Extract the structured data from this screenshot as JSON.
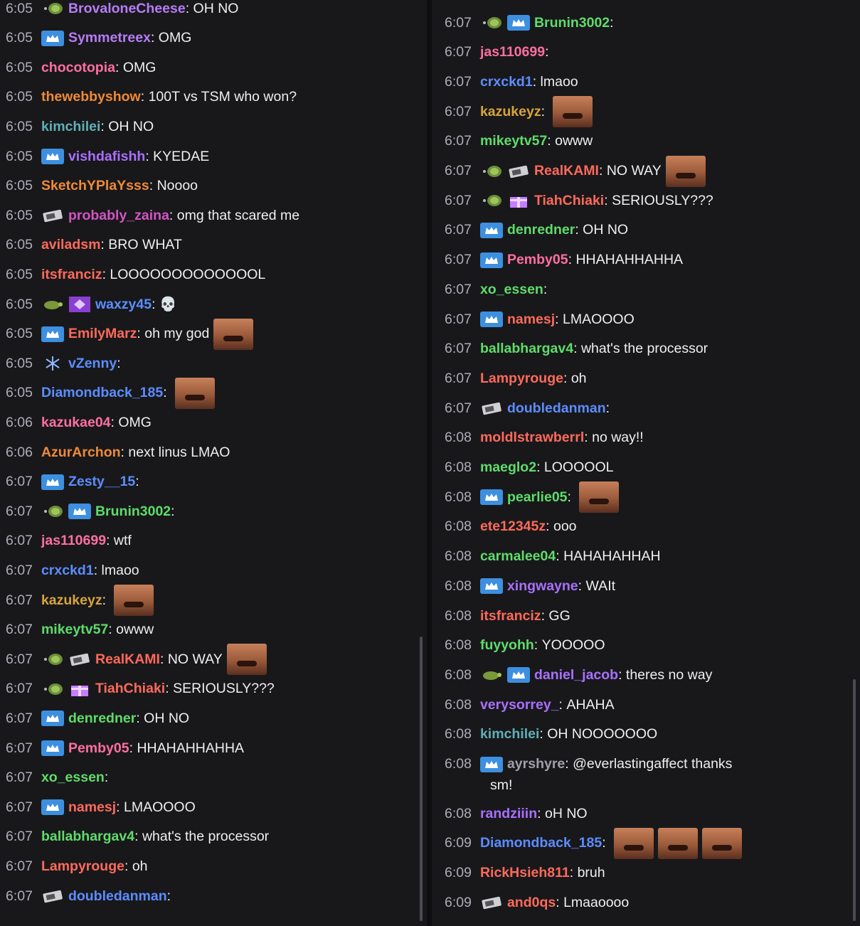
{
  "left": [
    {
      "time": "6:05",
      "badges": [
        "dot-icon"
      ],
      "user": "BrovaloneCheese",
      "color": "#b77cf5",
      "text": "OH NO",
      "emotes": 0
    },
    {
      "time": "6:05",
      "badges": [
        "crown-icon"
      ],
      "user": "Symmetreex",
      "color": "#b77cf5",
      "text": "OMG",
      "emotes": 0
    },
    {
      "time": "6:05",
      "badges": [],
      "user": "chocotopia",
      "color": "#ff6f9f",
      "text": "OMG",
      "emotes": 0
    },
    {
      "time": "6:05",
      "badges": [],
      "user": "thewebbyshow",
      "color": "#f08a38",
      "text": "100T vs TSM who won?",
      "emotes": 0
    },
    {
      "time": "6:05",
      "badges": [],
      "user": "kimchilei",
      "color": "#5fb0b6",
      "text": "OH NO",
      "emotes": 0
    },
    {
      "time": "6:05",
      "badges": [
        "crown-icon"
      ],
      "user": "vishdafishh",
      "color": "#a970ff",
      "text": "KYEDAE",
      "emotes": 0
    },
    {
      "time": "6:05",
      "badges": [],
      "user": "SketchYPlaYsss",
      "color": "#f08a38",
      "text": "Noooo",
      "emotes": 0
    },
    {
      "time": "6:05",
      "badges": [
        "gpu-icon"
      ],
      "user": "probably_zaina",
      "color": "#d254c4",
      "text": "omg that scared me",
      "emotes": 0
    },
    {
      "time": "6:05",
      "badges": [],
      "user": "aviladsm",
      "color": "#ff6a5a",
      "text": "BRO WHAT",
      "emotes": 0
    },
    {
      "time": "6:05",
      "badges": [],
      "user": "itsfranciz",
      "color": "#ff6a5a",
      "text": "LOOOOOOOOOOOOOL",
      "emotes": 0
    },
    {
      "time": "6:05",
      "badges": [
        "turtle-icon",
        "diamond-icon"
      ],
      "user": "waxzy45",
      "color": "#5c8dff",
      "text": "💀",
      "emotes": 0
    },
    {
      "time": "6:05",
      "badges": [
        "crown-icon"
      ],
      "user": "EmilyMarz",
      "color": "#ff6a5a",
      "text": "oh my god",
      "emotes": 1
    },
    {
      "time": "6:05",
      "badges": [
        "snowflake-icon"
      ],
      "user": "vZenny",
      "color": "#5c8dff",
      "text": "",
      "emotes": 0
    },
    {
      "time": "6:05",
      "badges": [],
      "user": "Diamondback_185",
      "color": "#5c8dff",
      "text": "",
      "emotes": 1
    },
    {
      "time": "6:06",
      "badges": [],
      "user": "kazukae04",
      "color": "#ff6f9f",
      "text": "OMG",
      "emotes": 0
    },
    {
      "time": "6:06",
      "badges": [],
      "user": "AzurArchon",
      "color": "#f08a38",
      "text": "next linus LMAO",
      "emotes": 0
    },
    {
      "time": "6:07",
      "badges": [
        "crown-icon"
      ],
      "user": "Zesty__15",
      "color": "#5c8dff",
      "text": "",
      "emotes": 0
    },
    {
      "time": "6:07",
      "badges": [
        "dot-icon",
        "crown-icon"
      ],
      "user": "Brunin3002",
      "color": "#5fdc6a",
      "text": "",
      "emotes": 0
    },
    {
      "time": "6:07",
      "badges": [],
      "user": "jas110699",
      "color": "#ff6f9f",
      "text": "wtf",
      "emotes": 0
    },
    {
      "time": "6:07",
      "badges": [],
      "user": "crxckd1",
      "color": "#5c8dff",
      "text": "lmaoo",
      "emotes": 0
    },
    {
      "time": "6:07",
      "badges": [],
      "user": "kazukeyz",
      "color": "#d8a43a",
      "text": "",
      "emotes": 1
    },
    {
      "time": "6:07",
      "badges": [],
      "user": "mikeytv57",
      "color": "#5fdc6a",
      "text": "owww",
      "emotes": 0
    },
    {
      "time": "6:07",
      "badges": [
        "dot-icon",
        "gpu-icon"
      ],
      "user": "RealKAMI",
      "color": "#ff6a5a",
      "text": "NO WAY",
      "emotes": 1
    },
    {
      "time": "6:07",
      "badges": [
        "dot-icon",
        "gift-icon"
      ],
      "user": "TiahChiaki",
      "color": "#ff6a5a",
      "text": "SERIOUSLY???",
      "emotes": 0
    },
    {
      "time": "6:07",
      "badges": [
        "crown-icon"
      ],
      "user": "denredner",
      "color": "#5fdc6a",
      "text": "OH NO",
      "emotes": 0
    },
    {
      "time": "6:07",
      "badges": [
        "crown-icon"
      ],
      "user": "Pemby05",
      "color": "#ff6f9f",
      "text": "HHAHAHHAHHA",
      "emotes": 0
    },
    {
      "time": "6:07",
      "badges": [],
      "user": "xo_essen",
      "color": "#5fdc6a",
      "text": "",
      "emotes": 0
    },
    {
      "time": "6:07",
      "badges": [
        "crown-icon"
      ],
      "user": "namesj",
      "color": "#ff6a5a",
      "text": "LMAOOOO",
      "emotes": 0
    },
    {
      "time": "6:07",
      "badges": [],
      "user": "ballabhargav4",
      "color": "#5fdc6a",
      "text": "what's the processor",
      "emotes": 0
    },
    {
      "time": "6:07",
      "badges": [],
      "user": "Lampyrouge",
      "color": "#ff6a5a",
      "text": "oh",
      "emotes": 0
    },
    {
      "time": "6:07",
      "badges": [
        "gpu-icon"
      ],
      "user": "doubledanman",
      "color": "#5c8dff",
      "text": "",
      "emotes": 0
    }
  ],
  "right": [
    {
      "time": "6:07",
      "badges": [
        "dot-icon",
        "crown-icon"
      ],
      "user": "Brunin3002",
      "color": "#5fdc6a",
      "text": "",
      "emotes": 0
    },
    {
      "time": "6:07",
      "badges": [],
      "user": "jas110699",
      "color": "#ff6f9f",
      "text": "",
      "emotes": 0
    },
    {
      "time": "6:07",
      "badges": [],
      "user": "crxckd1",
      "color": "#5c8dff",
      "text": "lmaoo",
      "emotes": 0
    },
    {
      "time": "6:07",
      "badges": [],
      "user": "kazukeyz",
      "color": "#d8a43a",
      "text": "",
      "emotes": 1
    },
    {
      "time": "6:07",
      "badges": [],
      "user": "mikeytv57",
      "color": "#5fdc6a",
      "text": "owww",
      "emotes": 0
    },
    {
      "time": "6:07",
      "badges": [
        "dot-icon",
        "gpu-icon"
      ],
      "user": "RealKAMI",
      "color": "#ff6a5a",
      "text": "NO WAY",
      "emotes": 1
    },
    {
      "time": "6:07",
      "badges": [
        "dot-icon",
        "gift-icon"
      ],
      "user": "TiahChiaki",
      "color": "#ff6a5a",
      "text": "SERIOUSLY???",
      "emotes": 0
    },
    {
      "time": "6:07",
      "badges": [
        "crown-icon"
      ],
      "user": "denredner",
      "color": "#5fdc6a",
      "text": "OH NO",
      "emotes": 0
    },
    {
      "time": "6:07",
      "badges": [
        "crown-icon"
      ],
      "user": "Pemby05",
      "color": "#ff6f9f",
      "text": "HHAHAHHAHHA",
      "emotes": 0
    },
    {
      "time": "6:07",
      "badges": [],
      "user": "xo_essen",
      "color": "#5fdc6a",
      "text": "",
      "emotes": 0
    },
    {
      "time": "6:07",
      "badges": [
        "crown-icon"
      ],
      "user": "namesj",
      "color": "#ff6a5a",
      "text": "LMAOOOO",
      "emotes": 0
    },
    {
      "time": "6:07",
      "badges": [],
      "user": "ballabhargav4",
      "color": "#5fdc6a",
      "text": "what's the processor",
      "emotes": 0
    },
    {
      "time": "6:07",
      "badges": [],
      "user": "Lampyrouge",
      "color": "#ff6a5a",
      "text": "oh",
      "emotes": 0
    },
    {
      "time": "6:07",
      "badges": [
        "gpu-icon"
      ],
      "user": "doubledanman",
      "color": "#5c8dff",
      "text": "",
      "emotes": 0
    },
    {
      "time": "6:08",
      "badges": [],
      "user": "moldlstrawberrl",
      "color": "#ff6a5a",
      "text": "no way!!",
      "emotes": 0
    },
    {
      "time": "6:08",
      "badges": [],
      "user": "maeglo2",
      "color": "#5fdc6a",
      "text": "LOOOOOL",
      "emotes": 0
    },
    {
      "time": "6:08",
      "badges": [
        "crown-icon"
      ],
      "user": "pearlie05",
      "color": "#5fdc6a",
      "text": "",
      "emotes": 1
    },
    {
      "time": "6:08",
      "badges": [],
      "user": "ete12345z",
      "color": "#ff6a5a",
      "text": "ooo",
      "emotes": 0
    },
    {
      "time": "6:08",
      "badges": [],
      "user": "carmalee04",
      "color": "#5fdc6a",
      "text": "HAHAHAHHAH",
      "emotes": 0
    },
    {
      "time": "6:08",
      "badges": [
        "crown-icon"
      ],
      "user": "xingwayne",
      "color": "#a970ff",
      "text": "WAIt",
      "emotes": 0
    },
    {
      "time": "6:08",
      "badges": [],
      "user": "itsfranciz",
      "color": "#ff6a5a",
      "text": "GG",
      "emotes": 0
    },
    {
      "time": "6:08",
      "badges": [],
      "user": "fuyyohh",
      "color": "#5fdc6a",
      "text": "YOOOOO",
      "emotes": 0
    },
    {
      "time": "6:08",
      "badges": [
        "turtle-icon",
        "crown-icon"
      ],
      "user": "daniel_jacob",
      "color": "#a970ff",
      "text": "theres no way",
      "emotes": 0
    },
    {
      "time": "6:08",
      "badges": [],
      "user": "verysorrey_",
      "color": "#a970ff",
      "text": "AHAHA",
      "emotes": 0
    },
    {
      "time": "6:08",
      "badges": [],
      "user": "kimchilei",
      "color": "#5fb0b6",
      "text": "OH NOOOOOOO",
      "emotes": 0
    },
    {
      "time": "6:08",
      "badges": [
        "crown-icon"
      ],
      "user": "ayrshyre",
      "color": "#a0a0aa",
      "text": "@everlastingaffect thanks",
      "emotes": 0,
      "wrap": "sm!"
    },
    {
      "time": "6:08",
      "badges": [],
      "user": "randziiin",
      "color": "#a970ff",
      "text": "oH NO",
      "emotes": 0
    },
    {
      "time": "6:09",
      "badges": [],
      "user": "Diamondback_185",
      "color": "#5c8dff",
      "text": "",
      "emotes": 3
    },
    {
      "time": "6:09",
      "badges": [],
      "user": "RickHsieh811",
      "color": "#ff6a5a",
      "text": "bruh",
      "emotes": 0
    },
    {
      "time": "6:09",
      "badges": [
        "gpu-icon"
      ],
      "user": "and0qs",
      "color": "#ff6a5a",
      "text": "Lmaaoooo",
      "emotes": 0
    }
  ]
}
